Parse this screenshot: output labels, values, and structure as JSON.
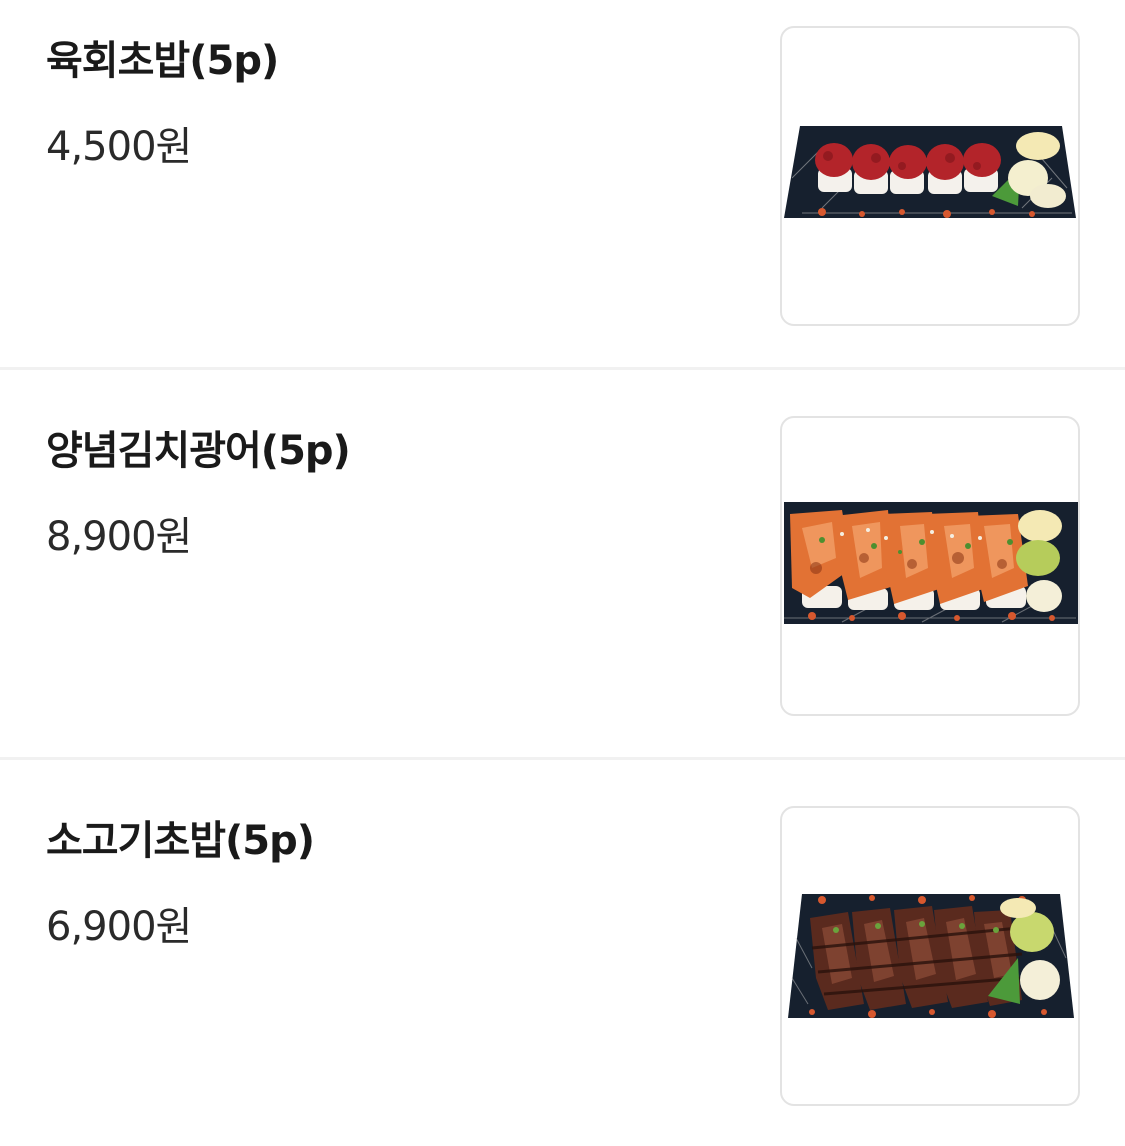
{
  "menu": {
    "items": [
      {
        "name": "육회초밥(5p)",
        "price": "4,500원",
        "image_icon": "yukhoe-sushi-photo",
        "image_alt": "육회초밥(5p)"
      },
      {
        "name": "양념김치광어(5p)",
        "price": "8,900원",
        "image_icon": "kimchi-flatfish-sushi-photo",
        "image_alt": "양념김치광어(5p)"
      },
      {
        "name": "소고기초밥(5p)",
        "price": "6,900원",
        "image_icon": "beef-sushi-photo",
        "image_alt": "소고기초밥(5p)"
      }
    ]
  },
  "colors": {
    "tray_dark": "#16202e",
    "tray_pattern": "#c9c9c9",
    "tray_accent": "#d7582e",
    "yukhoe_red": "#b3242a",
    "kimchi_orange": "#e27234",
    "beef_brown": "#5a2a1e",
    "ginger_yellow": "#f4e9b4",
    "wasabi_green": "#b6cc5b"
  }
}
